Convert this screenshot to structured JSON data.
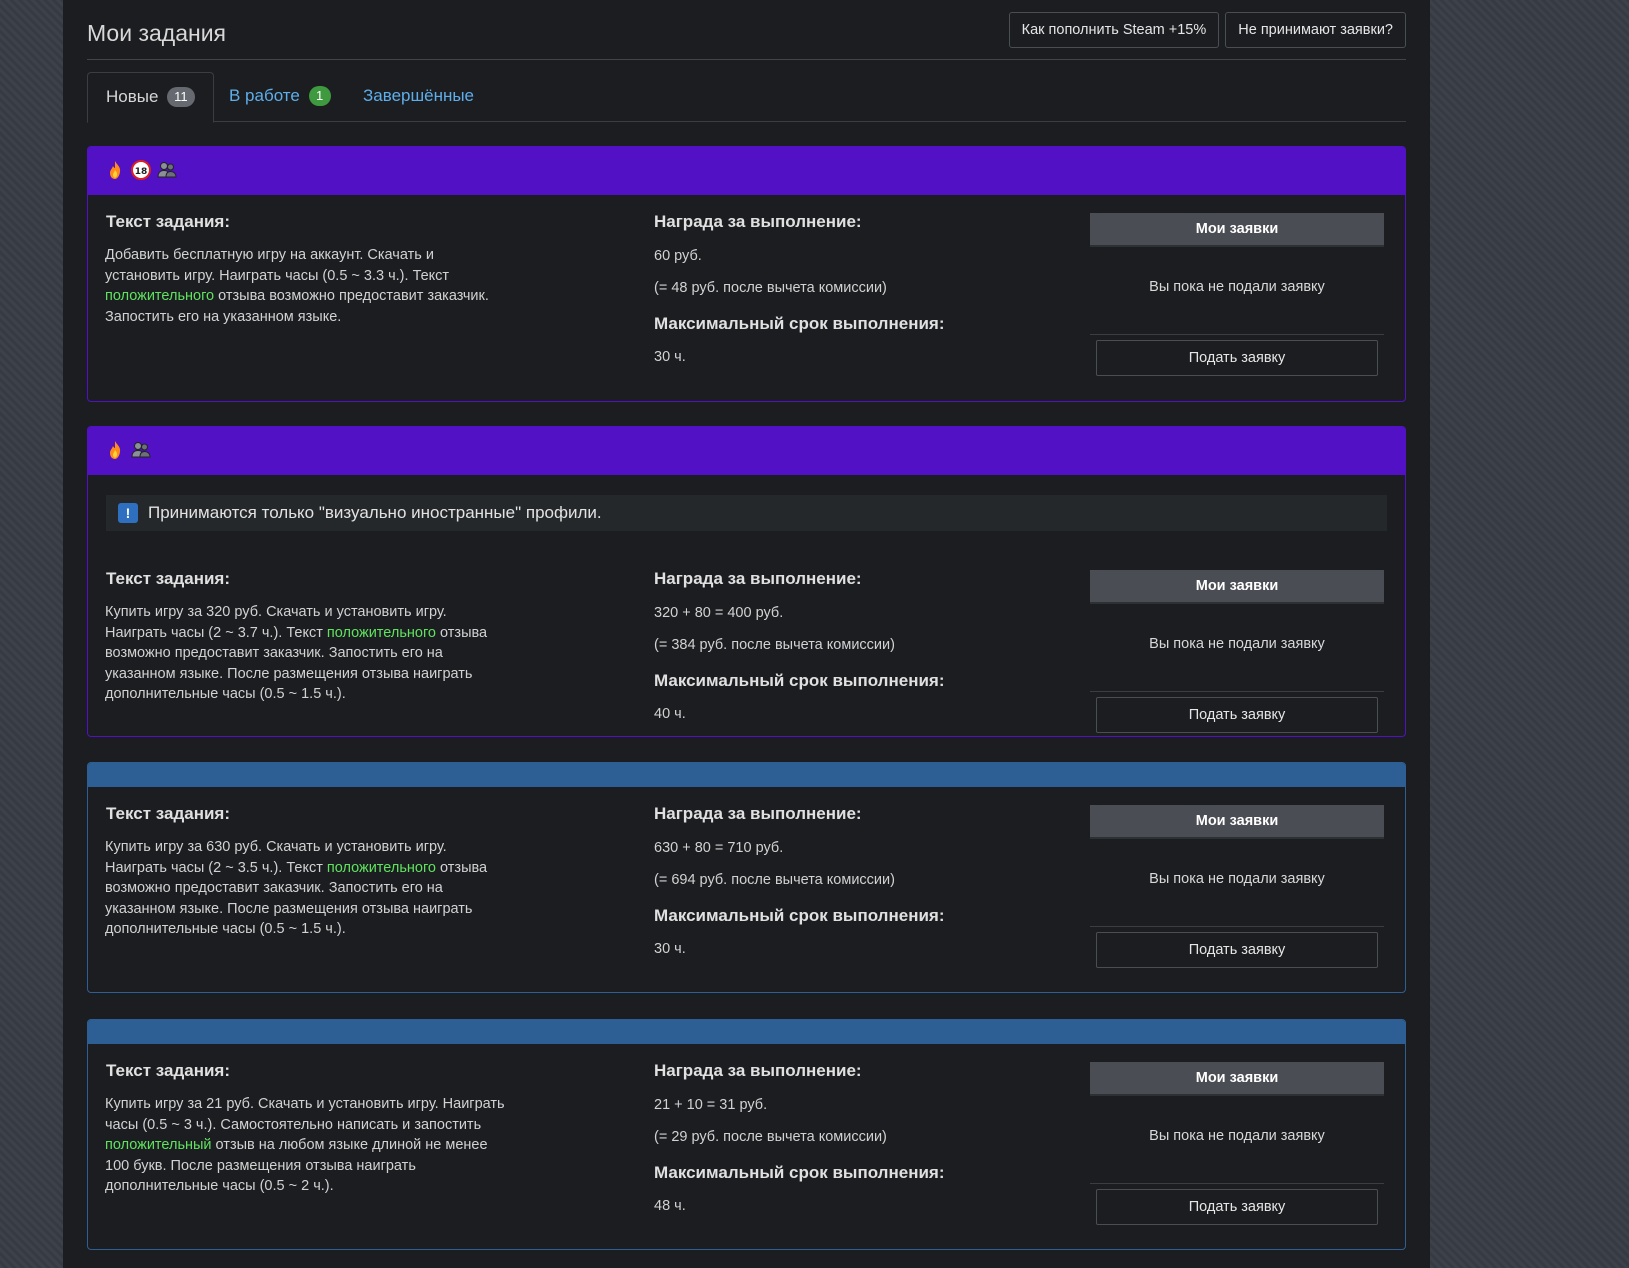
{
  "page_title": "Мои задания",
  "header_buttons": [
    "Как пополнить Steam +15%",
    "Не принимают заявки?"
  ],
  "tabs": [
    {
      "label": "Новые",
      "badge": "11"
    },
    {
      "label": "В работе",
      "badge": "1"
    },
    {
      "label": "Завершённые"
    }
  ],
  "labels": {
    "task_text": "Текст задания:",
    "reward": "Награда за выполнение:",
    "deadline": "Максимальный срок выполнения:",
    "my_requests": "Мои заявки",
    "not_submitted": "Вы пока не подали заявку",
    "submit": "Подать заявку"
  },
  "colors": {
    "purple_header": "#5211c4",
    "blue_header": "#2e5f94",
    "highlight_green": "#5fe35f",
    "link_blue": "#5eaeea"
  },
  "tasks": [
    {
      "icons": [
        "fire-icon",
        "age-18-icon",
        "users-icon"
      ],
      "header_color": "purple",
      "notice": null,
      "text_before": "Добавить бесплатную игру на аккаунт. Скачать и установить игру. Наиграть часы (0.5 ~ 3.3 ч.). Текст ",
      "text_highlight": "положительного",
      "text_after": " отзыва возможно предоставит заказчик. Запостить его на указанном языке.",
      "reward": "60 руб.",
      "reward_net": "(= 48 руб. после вычета комиссии)",
      "deadline": "30 ч."
    },
    {
      "icons": [
        "fire-icon",
        "users-icon"
      ],
      "header_color": "purple",
      "notice": "Принимаются только \"визуально иностранные\" профили.",
      "text_before": "Купить игру за 320 руб. Скачать и установить игру. Наиграть часы (2 ~ 3.7 ч.). Текст ",
      "text_highlight": "положительного",
      "text_after": " отзыва возможно предоставит заказчик. Запостить его на указанном языке. После размещения отзыва наиграть дополнительные часы (0.5 ~ 1.5 ч.).",
      "reward": "320 + 80 = 400 руб.",
      "reward_net": "(= 384 руб. после вычета комиссии)",
      "deadline": "40 ч."
    },
    {
      "icons": [],
      "header_color": "blue",
      "notice": null,
      "text_before": "Купить игру за 630 руб. Скачать и установить игру. Наиграть часы (2 ~ 3.5 ч.). Текст ",
      "text_highlight": "положительного",
      "text_after": " отзыва возможно предоставит заказчик. Запостить его на указанном языке. После размещения отзыва наиграть дополнительные часы (0.5 ~ 1.5 ч.).",
      "reward": "630 + 80 = 710 руб.",
      "reward_net": "(= 694 руб. после вычета комиссии)",
      "deadline": "30 ч."
    },
    {
      "icons": [],
      "header_color": "blue",
      "notice": null,
      "text_before": "Купить игру за 21 руб. Скачать и установить игру. Наиграть часы (0.5 ~ 3 ч.). Самостоятельно написать и запостить ",
      "text_highlight": "положительный",
      "text_after": " отзыв на любом языке длиной не менее 100 букв. После размещения отзыва наиграть дополнительные часы (0.5 ~ 2 ч.).",
      "reward": "21 + 10 = 31 руб.",
      "reward_net": "(= 29 руб. после вычета комиссии)",
      "deadline": "48 ч."
    }
  ]
}
